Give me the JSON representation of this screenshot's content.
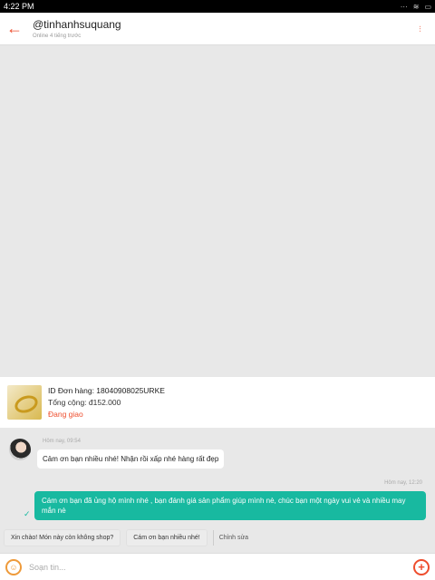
{
  "status_bar": {
    "time": "4:22 PM",
    "icons": [
      "more-dots-icon",
      "wifi-icon",
      "battery-icon"
    ]
  },
  "header": {
    "username": "@tinhanhsuquang",
    "presence": "Online 4 tiếng trước",
    "more_label": "..."
  },
  "order": {
    "id_text": "ID Đơn hàng: 18040908025URKE",
    "total_text": "Tổng cộng: đ152.000",
    "status_text": "Đang giao"
  },
  "messages": [
    {
      "side": "left",
      "time": "Hôm nay, 09:54",
      "text": "Cảm ơn bạn nhiều nhé! Nhận rồi xấp nhé hàng rất đẹp"
    },
    {
      "side": "right",
      "time": "Hôm nay, 12:20",
      "text": "Cám ơn bạn đã ủng hộ mình nhé , bạn đánh giá sản phẩm giúp mình nè, chúc bạn một ngày vui vẻ và nhiều may mắn nè"
    }
  ],
  "quick_replies": [
    "Xin chào! Món này còn không shop?",
    "Cám ơn bạn nhiều nhé!"
  ],
  "quick_reply_edit": "Chỉnh sửa",
  "input": {
    "placeholder": "Soạn tin..."
  },
  "colors": {
    "accent": "#ee4d2d",
    "teal_bubble": "#18b9a0"
  }
}
